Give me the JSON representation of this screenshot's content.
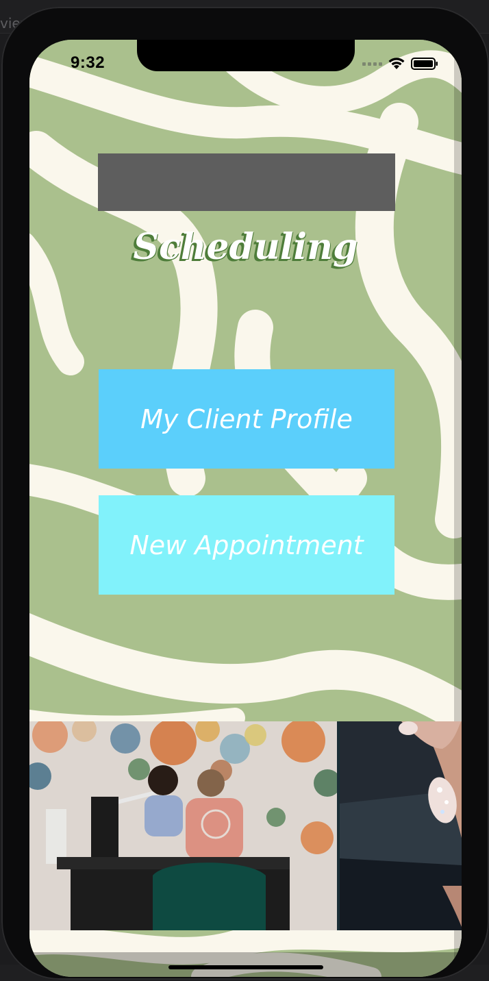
{
  "host": {
    "partial_label": "viev"
  },
  "status_bar": {
    "time": "9:32"
  },
  "screen": {
    "title": "Scheduling",
    "buttons": {
      "client_profile": "My Client Profile",
      "new_appointment": "New Appointment"
    }
  },
  "colors": {
    "background_green": "#aac08d",
    "swirl_cream": "#faf7ec",
    "button_client_profile": "#5bcffb",
    "button_new_appointment": "#81f2fb",
    "title_shadow": "#4e7d3a",
    "header_box": "#5e5e5e"
  },
  "icons": [
    "signal-icon",
    "wifi-icon",
    "battery-icon"
  ],
  "gallery": {
    "photo_count_visible": 2
  }
}
